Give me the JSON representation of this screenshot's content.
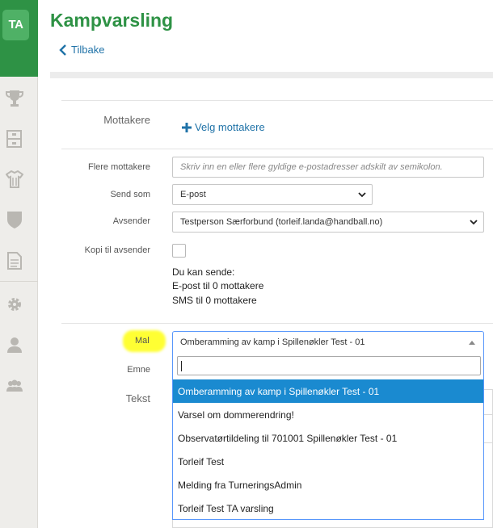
{
  "sidebar": {
    "logo": "TA",
    "icons": [
      "trophy-icon",
      "calendar-icon",
      "jersey-icon",
      "shield-icon",
      "document-icon",
      "gear-icon",
      "user-icon",
      "users-icon"
    ]
  },
  "header": {
    "title": "Kampvarsling",
    "back_label": "Tilbake"
  },
  "form": {
    "recipients_label": "Mottakere",
    "choose_recipients": "Velg mottakere",
    "more_recipients_label": "Flere mottakere",
    "more_recipients_placeholder": "Skriv inn en eller flere gyldige e-postadresser adskilt av semikolon.",
    "send_as_label": "Send som",
    "send_as_value": "E-post",
    "sender_label": "Avsender",
    "sender_value": "Testperson Særforbund (torleif.landa@handball.no)",
    "copy_label": "Kopi til avsender",
    "can_send_heading": "Du kan sende:",
    "email_count": "E-post til 0 mottakere",
    "sms_count": "SMS til 0 mottakere",
    "template_label": "Mal",
    "subject_label": "Emne",
    "text_label": "Tekst"
  },
  "template_dropdown": {
    "selected": "Omberamming av kamp i Spillenøkler Test - 01",
    "search_value": "",
    "options": [
      "Omberamming av kamp i Spillenøkler Test - 01",
      "Varsel om dommerendring!",
      "Observatørtildeling til 701001 Spillenøkler Test - 01",
      "Torleif Test",
      "Melding fra TurneringsAdmin",
      "Torleif Test TA varsling"
    ],
    "highlighted_index": 0
  },
  "colors": {
    "brand_green": "#2e9245",
    "link_blue": "#2073a8",
    "option_highlight": "#1a8ad0",
    "annotation_yellow": "#ffff33"
  }
}
